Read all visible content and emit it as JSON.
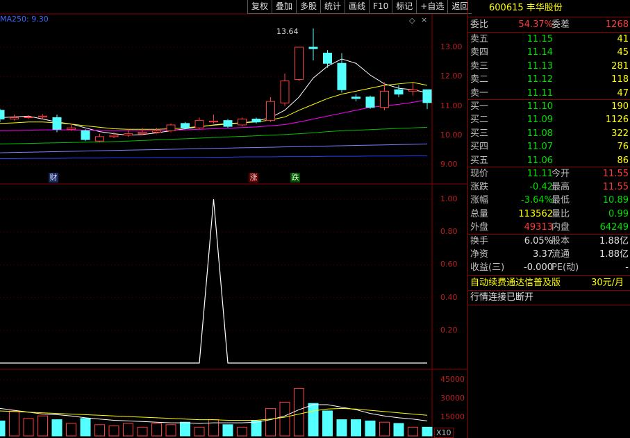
{
  "toolbar": {
    "buttons": [
      "复权",
      "叠加",
      "多股",
      "统计",
      "画线",
      "F10",
      "标记",
      "+自选",
      "返回"
    ]
  },
  "chart": {
    "ma_legend": "MA250: 9.30",
    "peak_label": "13.64",
    "price_axis": [
      "13.00",
      "12.00",
      "11.00",
      "10.00",
      "9.00"
    ],
    "indicator_axis": [
      "1.00",
      "0.80",
      "0.60",
      "0.40",
      "0.20"
    ],
    "volume_axis": [
      "45000",
      "30000",
      "15000"
    ],
    "volume_unit": "X10",
    "markers": {
      "cai": "财",
      "zhang": "涨",
      "die": "跌"
    }
  },
  "chart_data": {
    "type": "candlestick",
    "candles": [
      {
        "o": 10.85,
        "c": 10.55,
        "h": 10.9,
        "l": 10.45
      },
      {
        "o": 10.55,
        "c": 10.6,
        "h": 10.7,
        "l": 10.5
      },
      {
        "o": 10.6,
        "c": 10.62,
        "h": 10.68,
        "l": 10.55
      },
      {
        "o": 10.62,
        "c": 10.65,
        "h": 10.72,
        "l": 10.55
      },
      {
        "o": 10.6,
        "c": 10.2,
        "h": 10.7,
        "l": 10.1
      },
      {
        "o": 10.2,
        "c": 10.25,
        "h": 10.4,
        "l": 10.15
      },
      {
        "o": 10.15,
        "c": 9.85,
        "h": 10.2,
        "l": 9.8
      },
      {
        "o": 9.8,
        "c": 9.95,
        "h": 10.05,
        "l": 9.75
      },
      {
        "o": 9.95,
        "c": 10.0,
        "h": 10.1,
        "l": 9.9
      },
      {
        "o": 10.0,
        "c": 10.05,
        "h": 10.2,
        "l": 9.95
      },
      {
        "o": 10.05,
        "c": 10.1,
        "h": 10.25,
        "l": 10.0
      },
      {
        "o": 10.1,
        "c": 10.15,
        "h": 10.25,
        "l": 10.05
      },
      {
        "o": 10.15,
        "c": 10.35,
        "h": 10.4,
        "l": 10.1
      },
      {
        "o": 10.4,
        "c": 10.25,
        "h": 10.45,
        "l": 10.2
      },
      {
        "o": 10.25,
        "c": 10.5,
        "h": 10.6,
        "l": 10.2
      },
      {
        "o": 10.45,
        "c": 10.48,
        "h": 10.7,
        "l": 10.4
      },
      {
        "o": 10.5,
        "c": 10.3,
        "h": 10.55,
        "l": 10.25
      },
      {
        "o": 10.35,
        "c": 10.55,
        "h": 10.6,
        "l": 10.3
      },
      {
        "o": 10.55,
        "c": 10.45,
        "h": 10.6,
        "l": 10.4
      },
      {
        "o": 10.5,
        "c": 11.15,
        "h": 11.3,
        "l": 10.45
      },
      {
        "o": 11.1,
        "c": 11.85,
        "h": 12.1,
        "l": 11.0
      },
      {
        "o": 11.9,
        "c": 13.0,
        "h": 13.0,
        "l": 11.85
      },
      {
        "o": 13.0,
        "c": 12.95,
        "h": 13.64,
        "l": 12.55
      },
      {
        "o": 12.8,
        "c": 12.45,
        "h": 12.9,
        "l": 12.3
      },
      {
        "o": 12.45,
        "c": 11.55,
        "h": 12.8,
        "l": 11.45
      },
      {
        "o": 11.3,
        "c": 11.25,
        "h": 11.4,
        "l": 11.15
      },
      {
        "o": 11.3,
        "c": 10.95,
        "h": 11.35,
        "l": 10.9
      },
      {
        "o": 10.95,
        "c": 11.5,
        "h": 11.8,
        "l": 10.85
      },
      {
        "o": 11.55,
        "c": 11.4,
        "h": 11.7,
        "l": 11.3
      },
      {
        "o": 11.5,
        "c": 11.55,
        "h": 11.8,
        "l": 11.35
      },
      {
        "o": 11.55,
        "c": 11.11,
        "h": 11.55,
        "l": 10.89
      }
    ],
    "ma_short": [
      10.6,
      10.62,
      10.65,
      10.55,
      10.45,
      10.38,
      10.25,
      10.12,
      10.05,
      10.0,
      10.02,
      10.08,
      10.15,
      10.22,
      10.28,
      10.35,
      10.4,
      10.42,
      10.48,
      10.6,
      10.85,
      11.3,
      11.95,
      12.35,
      12.6,
      12.45,
      12.05,
      11.75,
      11.6,
      11.55,
      11.45
    ],
    "ma_mid": [
      10.4,
      10.42,
      10.45,
      10.45,
      10.42,
      10.38,
      10.32,
      10.27,
      10.22,
      10.2,
      10.2,
      10.2,
      10.22,
      10.25,
      10.3,
      10.34,
      10.38,
      10.42,
      10.45,
      10.52,
      10.62,
      10.85,
      11.05,
      11.25,
      11.4,
      11.5,
      11.6,
      11.7,
      11.75,
      11.8,
      11.7
    ],
    "ma_long": [
      10.15,
      10.16,
      10.17,
      10.18,
      10.18,
      10.18,
      10.17,
      10.16,
      10.15,
      10.15,
      10.15,
      10.16,
      10.17,
      10.18,
      10.2,
      10.22,
      10.24,
      10.26,
      10.28,
      10.32,
      10.36,
      10.45,
      10.55,
      10.65,
      10.75,
      10.85,
      10.95,
      11.0,
      11.05,
      11.12,
      11.2
    ],
    "ma60": [
      9.7,
      9.71,
      9.72,
      9.73,
      9.74,
      9.75,
      9.76,
      9.77,
      9.78,
      9.8,
      9.82,
      9.84,
      9.86,
      9.88,
      9.9,
      9.92,
      9.94,
      9.96,
      9.98,
      10.0,
      10.02,
      10.05,
      10.08,
      10.12,
      10.15,
      10.17,
      10.19,
      10.21,
      10.23,
      10.25,
      10.27
    ],
    "ma120": [
      9.4,
      9.41,
      9.42,
      9.43,
      9.44,
      9.45,
      9.46,
      9.47,
      9.48,
      9.49,
      9.5,
      9.51,
      9.52,
      9.53,
      9.54,
      9.55,
      9.56,
      9.57,
      9.58,
      9.59,
      9.6,
      9.61,
      9.62,
      9.63,
      9.64,
      9.65,
      9.66,
      9.67,
      9.68,
      9.69,
      9.7
    ],
    "ma250": [
      9.2,
      9.2,
      9.21,
      9.21,
      9.21,
      9.22,
      9.22,
      9.22,
      9.23,
      9.23,
      9.23,
      9.24,
      9.24,
      9.24,
      9.25,
      9.25,
      9.25,
      9.26,
      9.26,
      9.26,
      9.27,
      9.27,
      9.27,
      9.28,
      9.28,
      9.28,
      9.29,
      9.29,
      9.29,
      9.3,
      9.3
    ],
    "indicator": [
      0,
      0,
      0,
      0,
      0,
      0,
      0,
      0,
      0,
      0,
      0,
      0,
      0,
      0,
      0,
      1,
      0,
      0,
      0,
      0,
      0,
      0,
      0,
      0,
      0,
      0,
      0,
      0,
      0,
      0,
      0
    ],
    "volume": [
      12000,
      20000,
      14000,
      16000,
      13000,
      10000,
      14000,
      9000,
      8000,
      10000,
      7000,
      10000,
      9000,
      11000,
      7000,
      13000,
      9000,
      7000,
      12000,
      22000,
      27000,
      38000,
      26000,
      20000,
      13000,
      13000,
      12000,
      11000,
      10000,
      7000,
      7000
    ],
    "vol_ma": [
      22000,
      20500,
      19000,
      17500,
      17000,
      16000,
      14500,
      13500,
      12500,
      12000,
      11500,
      11000,
      10500,
      10500,
      10000,
      10500,
      10500,
      10500,
      11000,
      13000,
      16000,
      21000,
      25000,
      25000,
      23000,
      21000,
      18000,
      16000,
      14500,
      13500,
      12000
    ],
    "vol_ma2": [
      20000,
      19500,
      19000,
      18500,
      18000,
      17500,
      17000,
      16500,
      16000,
      15500,
      15000,
      14500,
      14000,
      13500,
      13000,
      13000,
      12500,
      12500,
      12500,
      13500,
      15000,
      17500,
      20000,
      21500,
      22000,
      21500,
      20500,
      19500,
      18500,
      17500,
      16500
    ]
  },
  "panel": {
    "title": "600615 丰华股份",
    "weibi_label": "委比",
    "weibi_value": "54.37%",
    "weicha_label": "委差",
    "weicha_value": "1268",
    "asks": [
      {
        "label": "卖五",
        "price": "11.15",
        "vol": "41"
      },
      {
        "label": "卖四",
        "price": "11.14",
        "vol": "45"
      },
      {
        "label": "卖三",
        "price": "11.13",
        "vol": "281"
      },
      {
        "label": "卖二",
        "price": "11.12",
        "vol": "118"
      },
      {
        "label": "卖一",
        "price": "11.11",
        "vol": "47"
      }
    ],
    "bids": [
      {
        "label": "买一",
        "price": "11.10",
        "vol": "190"
      },
      {
        "label": "买二",
        "price": "11.09",
        "vol": "1126"
      },
      {
        "label": "买三",
        "price": "11.08",
        "vol": "322"
      },
      {
        "label": "买四",
        "price": "11.07",
        "vol": "76"
      },
      {
        "label": "买五",
        "price": "11.06",
        "vol": "86"
      }
    ],
    "stats": [
      {
        "l1": "现价",
        "v1": "11.11",
        "c1": "green",
        "l2": "今开",
        "v2": "11.55",
        "c2": "red"
      },
      {
        "l1": "涨跌",
        "v1": "-0.42",
        "c1": "green",
        "l2": "最高",
        "v2": "11.55",
        "c2": "red"
      },
      {
        "l1": "涨幅",
        "v1": "-3.64%",
        "c1": "green",
        "l2": "最低",
        "v2": "10.89",
        "c2": "green"
      },
      {
        "l1": "总量",
        "v1": "113562",
        "c1": "yellow",
        "l2": "量比",
        "v2": "0.99",
        "c2": "green"
      },
      {
        "l1": "外盘",
        "v1": "49313",
        "c1": "red",
        "l2": "内盘",
        "v2": "64249",
        "c2": "green"
      }
    ],
    "stats2": [
      {
        "l1": "换手",
        "v1": "6.05%",
        "l2": "股本",
        "v2": "1.88亿"
      },
      {
        "l1": "净资",
        "v1": "3.37",
        "l2": "流通",
        "v2": "1.88亿"
      },
      {
        "l1": "收益(三)",
        "v1": "-0.000",
        "l2": "PE(动)",
        "v2": "-"
      }
    ],
    "ad_text": "自动续费通达信普及版",
    "ad_price": "30元/月",
    "status": "行情连接已断开"
  }
}
